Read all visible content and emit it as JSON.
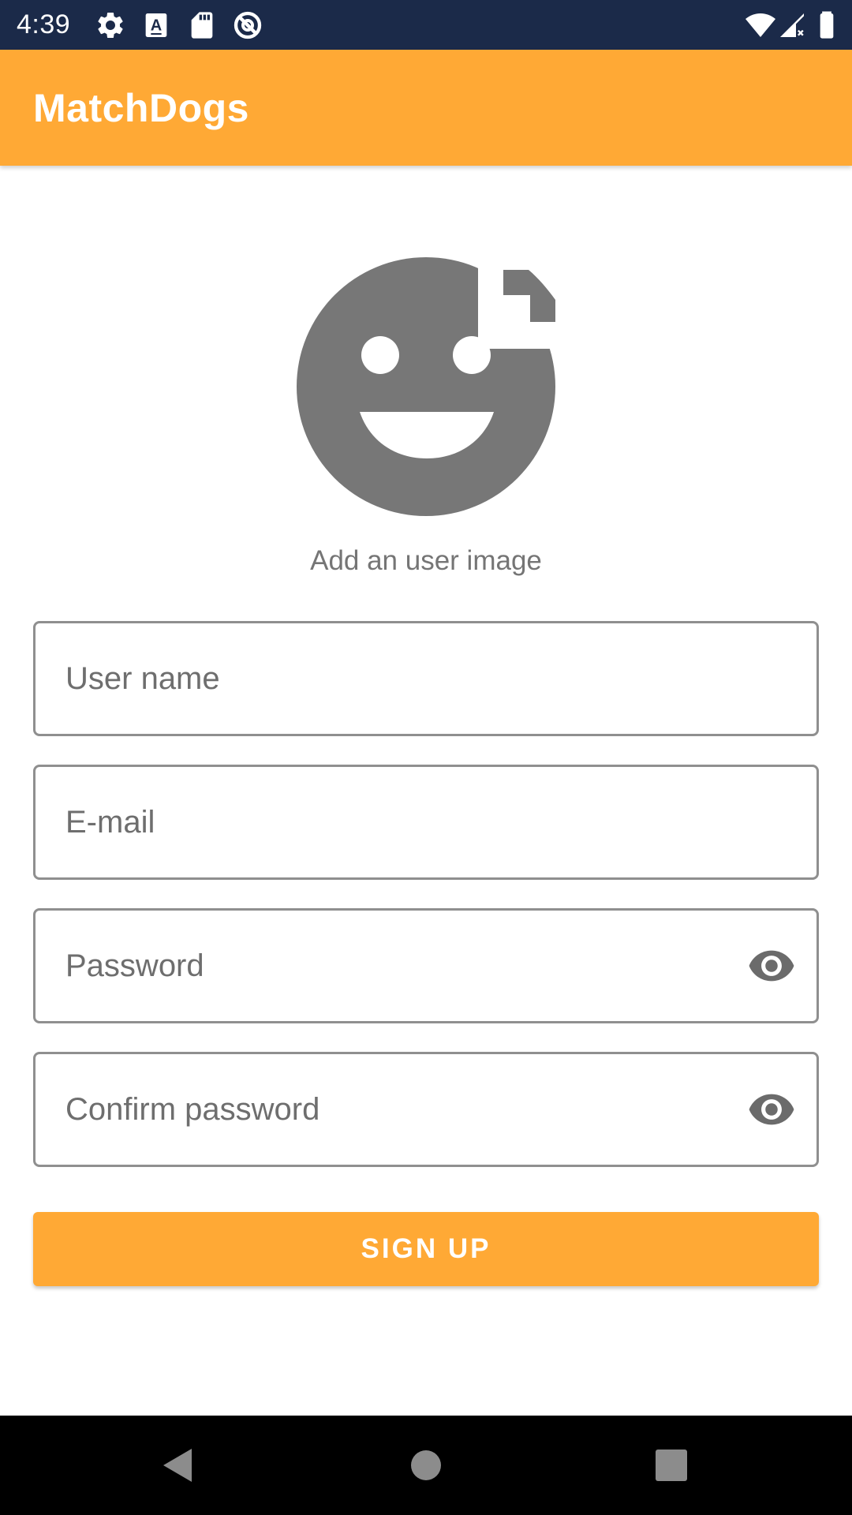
{
  "status_bar": {
    "time": "4:39",
    "left_icons": [
      "settings-icon",
      "text-format-icon",
      "sd-card-icon",
      "do-not-disturb-icon"
    ],
    "right_icons": [
      "wifi-icon",
      "signal-icon",
      "battery-icon"
    ],
    "background_color": "#1b2a49"
  },
  "app_bar": {
    "title": "MatchDogs",
    "color": "#ffa935"
  },
  "avatar": {
    "icon": "add-reaction-icon",
    "caption": "Add an user image"
  },
  "form": {
    "username": {
      "placeholder": "User name",
      "value": ""
    },
    "email": {
      "placeholder": "E-mail",
      "value": ""
    },
    "password": {
      "placeholder": "Password",
      "value": "",
      "toggle_icon": "eye-icon"
    },
    "confirm_password": {
      "placeholder": "Confirm password",
      "value": "",
      "toggle_icon": "eye-icon"
    }
  },
  "signup_button": {
    "label": "SIGN UP",
    "color": "#ffa935"
  },
  "nav_bar": {
    "buttons": [
      "back-icon",
      "home-icon",
      "recents-icon"
    ]
  }
}
